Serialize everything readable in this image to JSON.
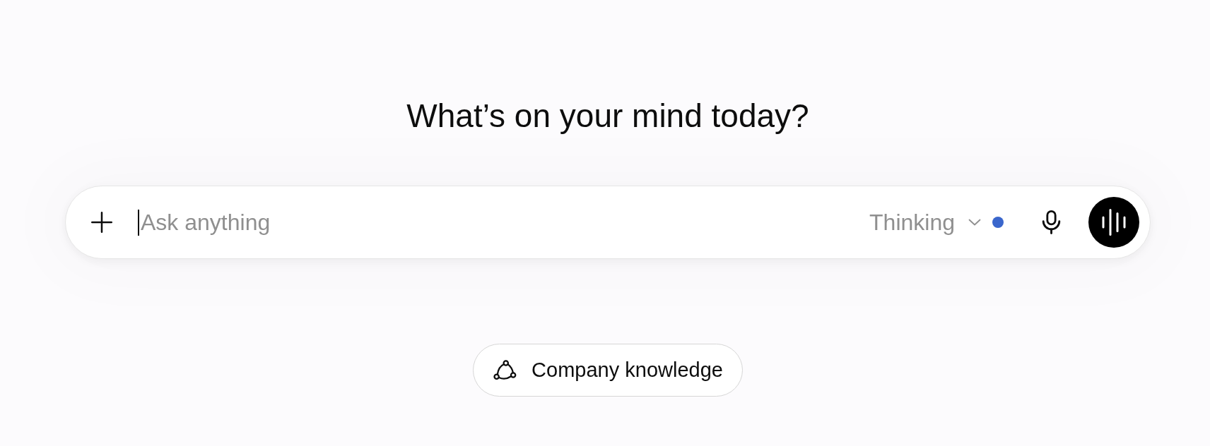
{
  "heading": "What’s on your mind today?",
  "composer": {
    "placeholder": "Ask anything",
    "focused": true,
    "mode": {
      "label": "Thinking"
    }
  },
  "suggestions": [
    {
      "label": "Company knowledge"
    }
  ]
}
